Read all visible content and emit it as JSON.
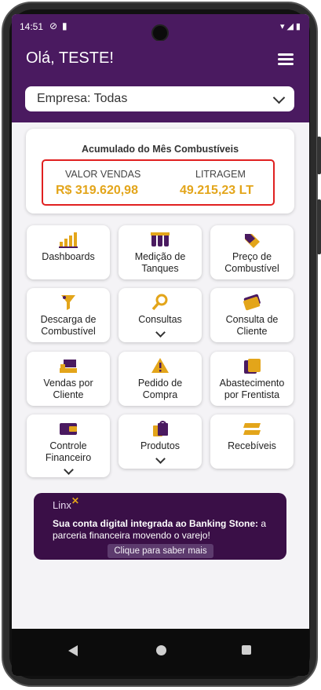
{
  "status_bar": {
    "time": "14:51"
  },
  "header": {
    "greeting": "Olá, TESTE!"
  },
  "company_select": {
    "label": "Empresa: Todas"
  },
  "summary": {
    "title": "Acumulado do Mês Combustíveis",
    "sales_label": "VALOR VENDAS",
    "sales_value": "R$ 319.620,98",
    "volume_label": "LITRAGEM",
    "volume_value": "49.215,23 LT"
  },
  "tiles": [
    {
      "line1": "Dashboards",
      "line2": ""
    },
    {
      "line1": "Medição de",
      "line2": "Tanques"
    },
    {
      "line1": "Preço de",
      "line2": "Combustível"
    },
    {
      "line1": "Descarga de",
      "line2": "Combustível"
    },
    {
      "line1": "Consultas",
      "line2": ""
    },
    {
      "line1": "Consulta de",
      "line2": "Cliente"
    },
    {
      "line1": "Vendas por",
      "line2": "Cliente"
    },
    {
      "line1": "Pedido de",
      "line2": "Compra"
    },
    {
      "line1": "Abastecimento",
      "line2": "por Frentista"
    },
    {
      "line1": "Controle",
      "line2": "Financeiro"
    },
    {
      "line1": "Produtos",
      "line2": ""
    },
    {
      "line1": "Recebíveis",
      "line2": ""
    }
  ],
  "banner": {
    "brand": "Linx",
    "line1_bold": "Sua conta digital integrada ao Banking Stone:",
    "line1_rest": " a",
    "line2": "parceria financeira movendo o varejo!",
    "cta": "Clique para saber mais"
  },
  "colors": {
    "primary": "#4a1a60",
    "accent": "#e3a51a",
    "highlight_border": "#e02020"
  }
}
